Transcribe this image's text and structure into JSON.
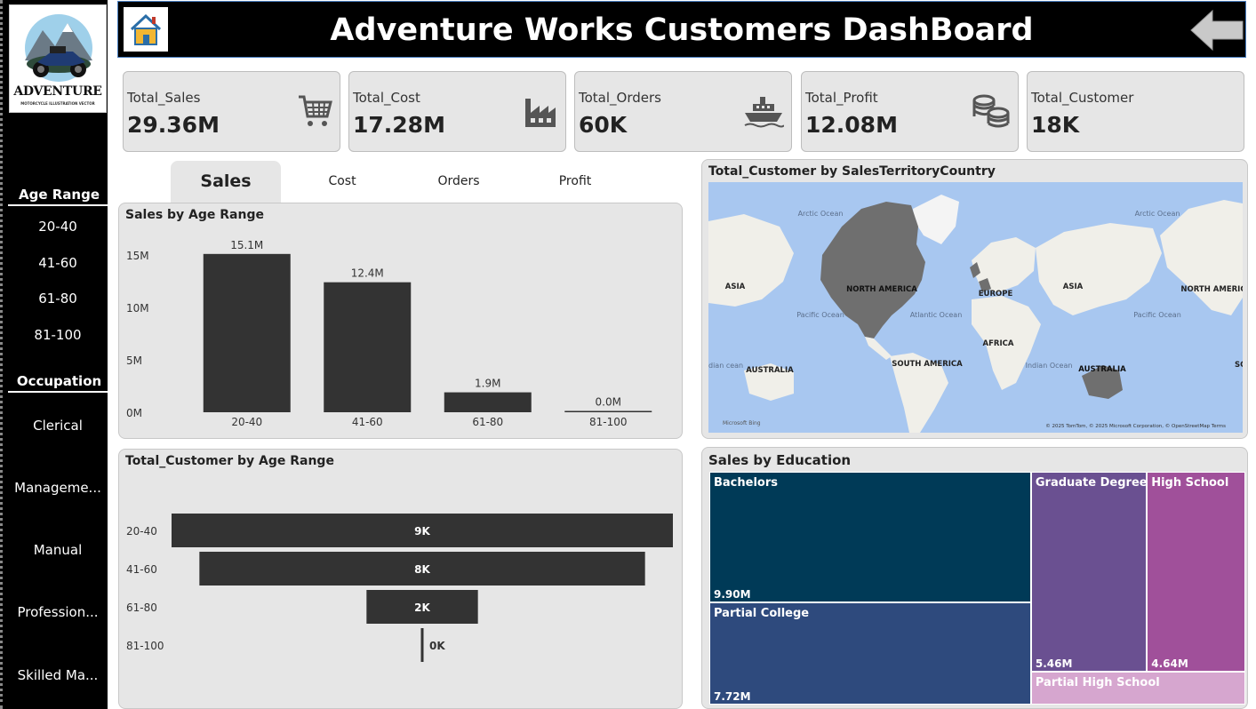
{
  "header": {
    "title": "Adventure Works Customers DashBoard"
  },
  "logo": {
    "text": "ADVENTURE",
    "subtext": "MOTORCYCLE ILLUSTRATION VECTOR"
  },
  "sidebar": {
    "age_heading": "Age Range",
    "age_items": [
      {
        "label": "20-40"
      },
      {
        "label": "41-60"
      },
      {
        "label": "61-80"
      },
      {
        "label": "81-100"
      }
    ],
    "occupation_heading": "Occupation",
    "occupation_items": [
      {
        "label": "Clerical"
      },
      {
        "label": "Manageme..."
      },
      {
        "label": "Manual"
      },
      {
        "label": "Profession..."
      },
      {
        "label": "Skilled Ma..."
      }
    ]
  },
  "kpis": [
    {
      "label": "Total_Sales",
      "value": "29.36M",
      "icon": "shopping-cart-icon"
    },
    {
      "label": "Total_Cost",
      "value": "17.28M",
      "icon": "factory-icon"
    },
    {
      "label": "Total_Orders",
      "value": "60K",
      "icon": "ship-icon"
    },
    {
      "label": "Total_Profit",
      "value": "12.08M",
      "icon": "coins-icon"
    },
    {
      "label": "Total_Customer",
      "value": "18K",
      "icon": ""
    }
  ],
  "tabs": [
    {
      "label": "Sales",
      "active": true
    },
    {
      "label": "Cost",
      "active": false
    },
    {
      "label": "Orders",
      "active": false
    },
    {
      "label": "Profit",
      "active": false
    }
  ],
  "map": {
    "title": "Total_Customer by SalesTerritoryCountry",
    "labels": {
      "arctic1": "Arctic Ocean",
      "arctic2": "Arctic Ocean",
      "asia1": "ASIA",
      "asia2": "ASIA",
      "north_america1": "NORTH AMERICA",
      "north_america2": "NORTH AMERIC",
      "europe": "EUROPE",
      "africa": "AFRICA",
      "pacific1": "Pacific Ocean",
      "pacific2": "Pacific Ocean",
      "atlantic": "Atlantic Ocean",
      "indian": "Indian Ocean",
      "indian_edge": "dian cean",
      "australia1": "AUSTRALIA",
      "australia2": "AUSTRALIA",
      "south_america": "SOUTH AMERICA",
      "so_edge": "SO",
      "bing": "Microsoft Bing",
      "attribution": "© 2025 TomTom, © 2025 Microsoft Corporation, © OpenStreetMap  Terms"
    }
  },
  "chart_data": [
    {
      "type": "bar",
      "title": "Sales by Age Range",
      "categories": [
        "20-40",
        "41-60",
        "61-80",
        "81-100"
      ],
      "values": [
        15.1,
        12.4,
        1.9,
        0.0
      ],
      "data_labels": [
        "15.1M",
        "12.4M",
        "1.9M",
        "0.0M"
      ],
      "unit": "M",
      "ylim": [
        0,
        15
      ],
      "yticks": [
        "0M",
        "5M",
        "10M",
        "15M"
      ],
      "color": "#333333"
    },
    {
      "type": "bar",
      "orientation": "funnel",
      "title": "Total_Customer by Age Range",
      "categories": [
        "20-40",
        "41-60",
        "61-80",
        "81-100"
      ],
      "values": [
        9,
        8,
        2,
        0
      ],
      "data_labels": [
        "9K",
        "8K",
        "2K",
        "0K"
      ],
      "unit": "K",
      "color": "#333333"
    },
    {
      "type": "treemap",
      "title": "Sales by Education",
      "items": [
        {
          "name": "Bachelors",
          "value": 9.9,
          "label": "9.90M",
          "color": "#003a57"
        },
        {
          "name": "Partial College",
          "value": 7.72,
          "label": "7.72M",
          "color": "#2e4a7d"
        },
        {
          "name": "Graduate Degree",
          "value": 5.46,
          "label": "5.46M",
          "color": "#6a5091"
        },
        {
          "name": "High School",
          "value": 4.64,
          "label": "4.64M",
          "color": "#a0509a"
        },
        {
          "name": "Partial High School",
          "value": 1.64,
          "label": "",
          "color": "#d6a6cf"
        }
      ]
    }
  ]
}
